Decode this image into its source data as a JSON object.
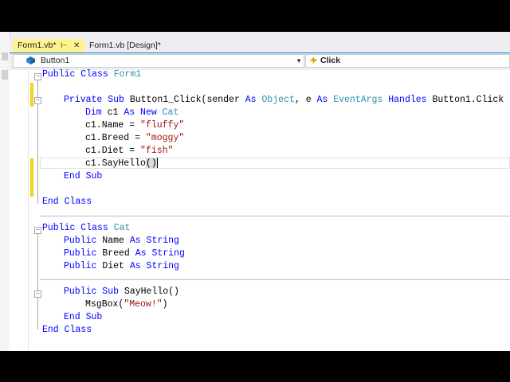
{
  "tabs": [
    {
      "label": "Form1.vb*",
      "pin_glyph": "⊢",
      "close_glyph": "✕"
    },
    {
      "label": "Form1.vb [Design]*"
    }
  ],
  "nav": {
    "object": "Button1",
    "event": "Click"
  },
  "code": {
    "l1": {
      "kw1": "Public Class",
      "name": " Form1"
    },
    "l2": {
      "kw1": "Private Sub",
      "t1": " Button1_Click(sender ",
      "kw2": "As",
      "sp1": " ",
      "ty1": "Object",
      "t2": ", e ",
      "kw3": "As",
      "sp2": " ",
      "ty2": "EventArgs",
      "sp3": " ",
      "kw4": "Handles",
      "t3": " Button1.Click"
    },
    "l3": {
      "kw1": "Dim",
      "t1": " c1 ",
      "kw2": "As New",
      "sp1": " ",
      "ty1": "Cat"
    },
    "l4": {
      "t1": "c1.Name = ",
      "s1": "\"fluffy\""
    },
    "l5": {
      "t1": "c1.Breed = ",
      "s1": "\"moggy\""
    },
    "l6": {
      "t1": "c1.Diet = ",
      "s1": "\"fish\""
    },
    "l7": {
      "t1": "c1.SayHello",
      "b1": "(",
      "b2": ")"
    },
    "l8": {
      "kw1": "End Sub"
    },
    "l9": {
      "kw1": "End Class"
    },
    "l10": {
      "kw1": "Public Class",
      "sp1": " ",
      "ty1": "Cat"
    },
    "l11": {
      "kw1": "Public",
      "t1": " Name ",
      "kw2": "As String"
    },
    "l12": {
      "kw1": "Public",
      "t1": " Breed ",
      "kw2": "As String"
    },
    "l13": {
      "kw1": "Public",
      "t1": " Diet ",
      "kw2": "As String"
    },
    "l14": {
      "kw1": "Public Sub",
      "t1": " SayHello()"
    },
    "l15": {
      "t1": "MsgBox(",
      "s1": "\"Meow!\"",
      "t2": ")"
    },
    "l16": {
      "kw1": "End Sub"
    },
    "l17": {
      "kw1": "End Class"
    }
  },
  "colors": {
    "keyword": "#0000ff",
    "type": "#2b91af",
    "string": "#a31515",
    "changed": "#f2d21a",
    "active_tab": "#fff38f",
    "accent": "#007acc"
  }
}
